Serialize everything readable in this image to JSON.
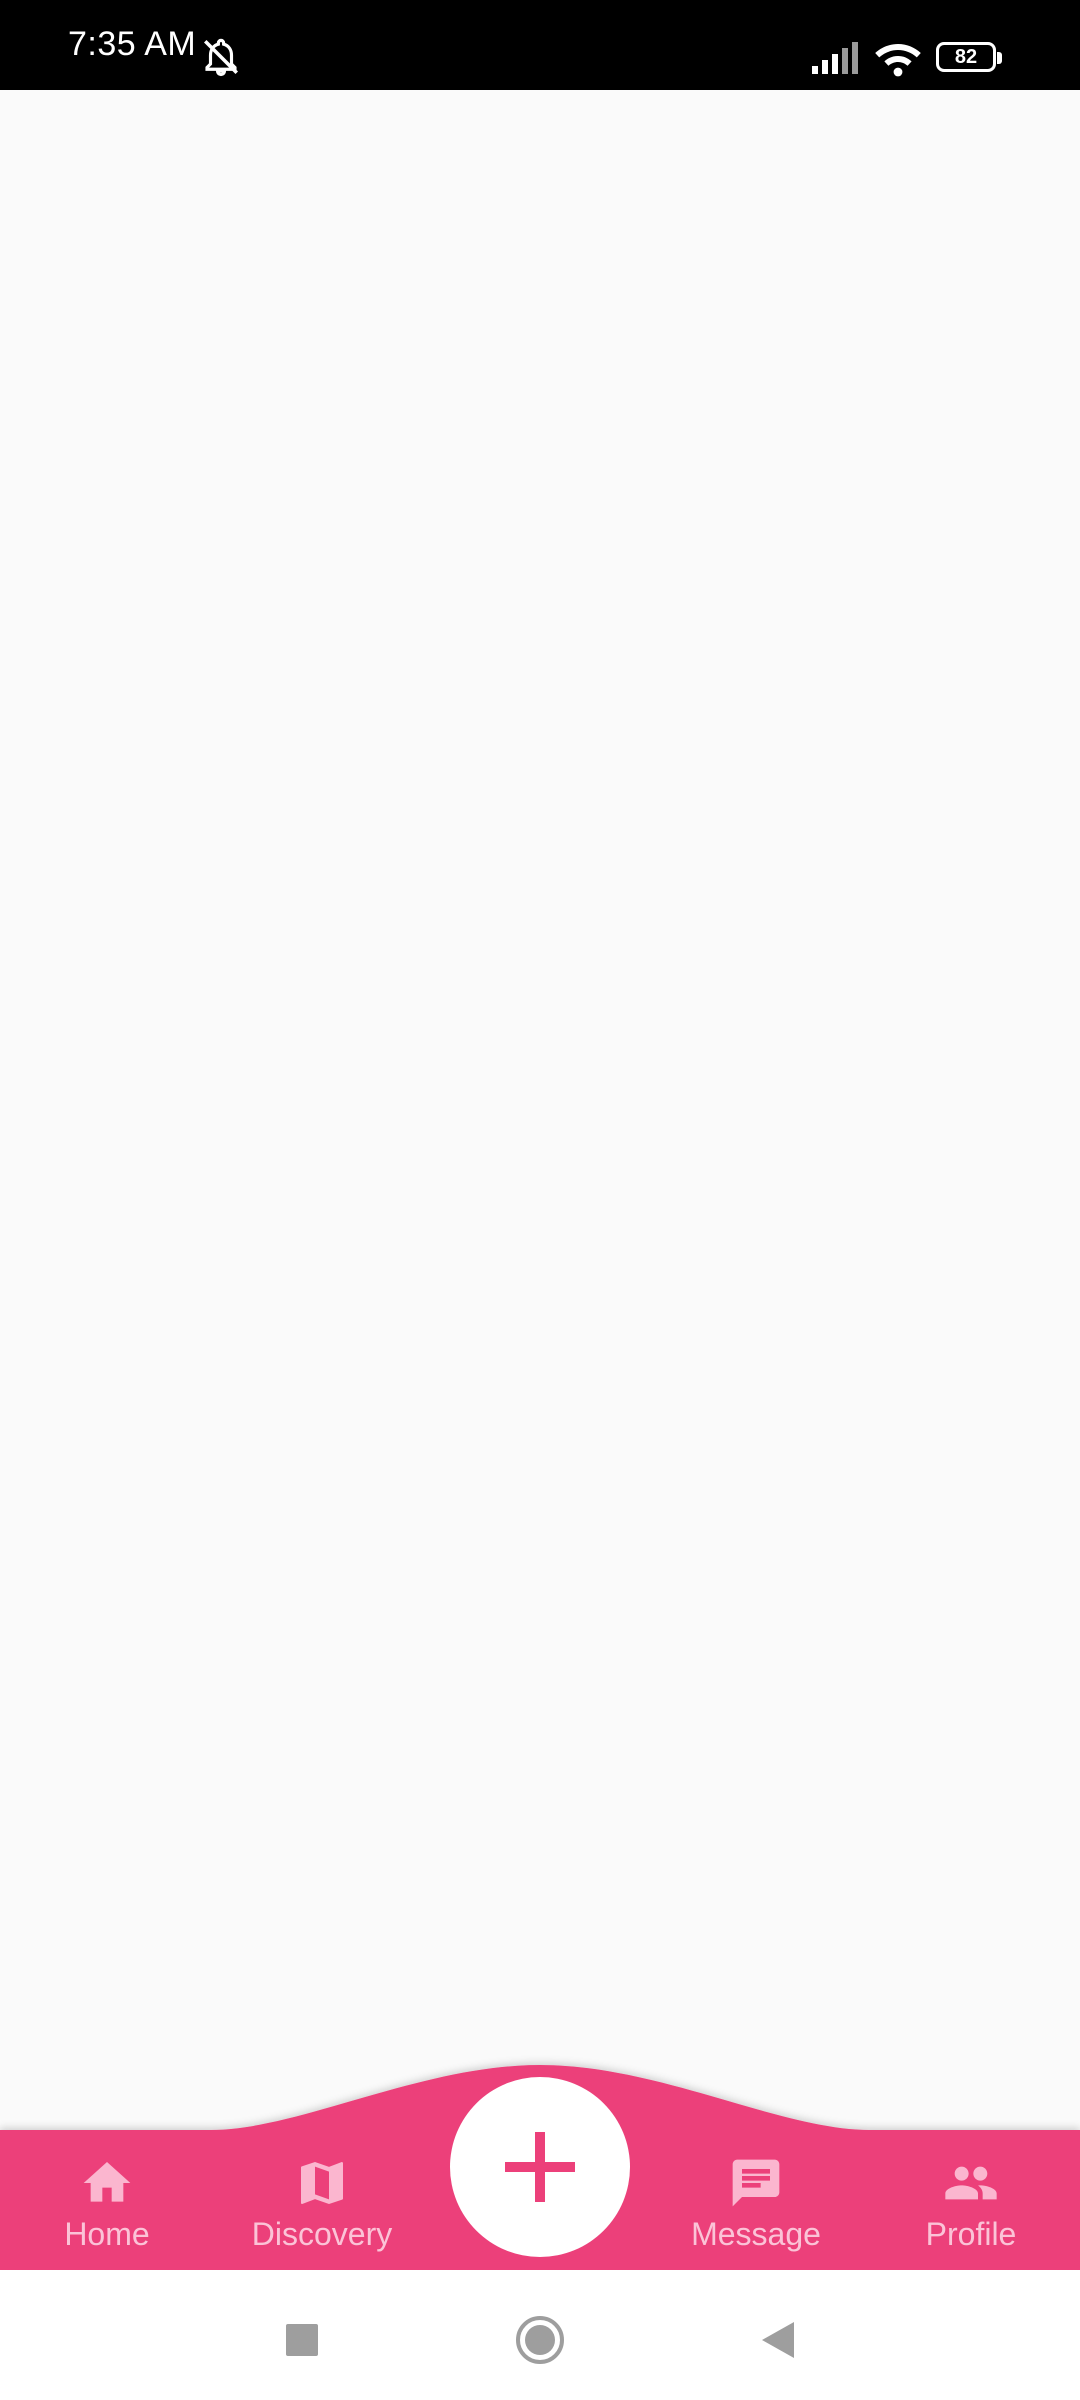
{
  "status_bar": {
    "time": "7:35 AM",
    "battery": "82",
    "icons": [
      "bell-off-icon",
      "signal-icon",
      "wifi-icon",
      "battery-icon"
    ]
  },
  "bottom_nav": {
    "items": [
      {
        "label": "Home",
        "icon": "home-icon"
      },
      {
        "label": "Discovery",
        "icon": "map-icon"
      },
      {
        "label": "Message",
        "icon": "message-icon"
      },
      {
        "label": "Profile",
        "icon": "people-icon"
      }
    ],
    "fab_icon": "plus-icon"
  },
  "system_nav": {
    "buttons": [
      "recents-icon",
      "home-circle-icon",
      "back-icon"
    ]
  },
  "colors": {
    "accent": "#ec407a",
    "nav_item": "#fbb6cf",
    "status_bar": "#000000",
    "background": "#fafafa"
  }
}
